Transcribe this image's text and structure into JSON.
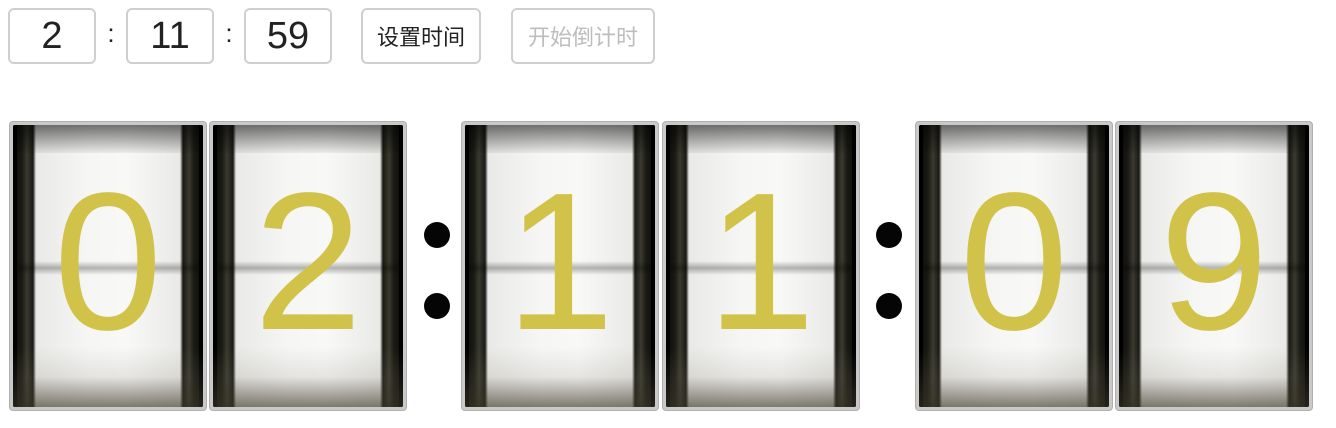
{
  "timer_inputs": {
    "hours": "2",
    "minutes": "11",
    "seconds": "59",
    "separator": ":"
  },
  "buttons": {
    "set_time": "设置时间",
    "start_countdown": "开始倒计时"
  },
  "clock": {
    "digits": [
      "0",
      "2",
      "1",
      "1",
      "0",
      "9"
    ],
    "digit_color": "#d1c349",
    "colon_color": "#050505"
  }
}
